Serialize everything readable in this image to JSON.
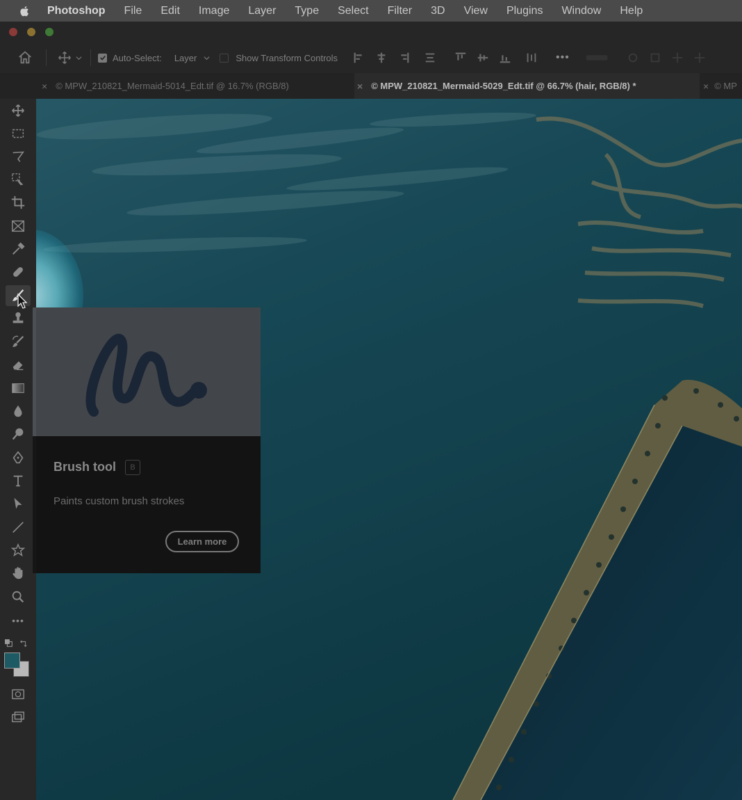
{
  "menubar": {
    "app_name": "Photoshop",
    "items": [
      "File",
      "Edit",
      "Image",
      "Layer",
      "Type",
      "Select",
      "Filter",
      "3D",
      "View",
      "Plugins",
      "Window",
      "Help"
    ]
  },
  "options_bar": {
    "auto_select_label": "Auto-Select:",
    "auto_select_checked": true,
    "auto_select_value": "Layer",
    "show_transform_label": "Show Transform Controls",
    "show_transform_checked": false,
    "more_label": "•••"
  },
  "tabs": [
    {
      "label": "© MPW_210821_Mermaid-5014_Edt.tif @ 16.7% (RGB/8)",
      "active": false
    },
    {
      "label": "© MPW_210821_Mermaid-5029_Edt.tif @ 66.7% (hair, RGB/8) *",
      "active": true
    },
    {
      "label": "© MP",
      "active": false
    }
  ],
  "toolbar": {
    "tools": [
      "move-tool",
      "marquee-tool",
      "lasso-tool",
      "object-selection-tool",
      "crop-tool",
      "frame-tool",
      "eyedropper-tool",
      "healing-brush-tool",
      "brush-tool",
      "clone-stamp-tool",
      "history-brush-tool",
      "eraser-tool",
      "gradient-tool",
      "blur-tool",
      "dodge-tool",
      "pen-tool",
      "type-tool",
      "path-selection-tool",
      "line-tool",
      "custom-shape-tool",
      "hand-tool",
      "zoom-tool",
      "more-tools"
    ],
    "active_tool": "brush-tool",
    "more_label": "•••",
    "foreground_color": "#1d5a63",
    "background_color": "#b9b9b9"
  },
  "tooltip": {
    "title": "Brush tool",
    "shortcut": "B",
    "description": "Paints custom brush strokes",
    "learn_more": "Learn more"
  },
  "colors": {
    "accent_glow": "#7fe3f0",
    "canvas_water": "#174a57"
  }
}
